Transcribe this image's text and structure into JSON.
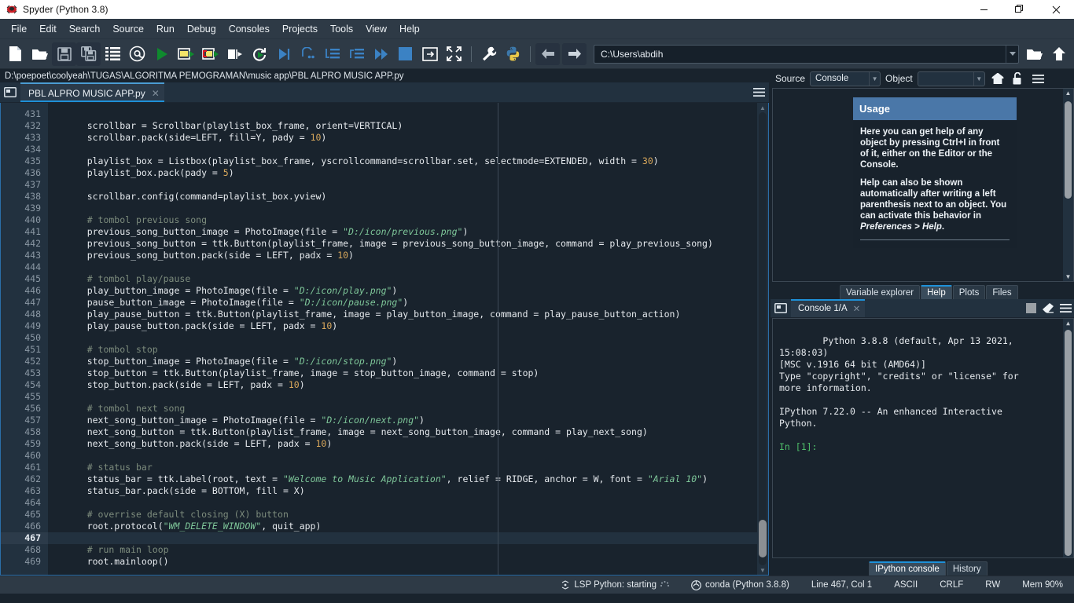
{
  "window": {
    "title": "Spyder (Python 3.8)",
    "app_icon": "spyder-logo-icon",
    "minimize": "minimize-icon",
    "maximize": "maximize-icon",
    "close": "close-icon"
  },
  "menubar": {
    "items": [
      "File",
      "Edit",
      "Search",
      "Source",
      "Run",
      "Debug",
      "Consoles",
      "Projects",
      "Tools",
      "View",
      "Help"
    ]
  },
  "toolbar": {
    "buttons": [
      {
        "name": "new-file-icon",
        "title": "New file"
      },
      {
        "name": "open-file-icon",
        "title": "Open file"
      },
      {
        "name": "save-file-icon",
        "title": "Save file"
      },
      {
        "name": "save-all-icon",
        "title": "Save all"
      },
      {
        "name": "file-switcher-icon",
        "title": "File switcher"
      },
      {
        "name": "find-symbols-icon",
        "title": "Symbol finder"
      },
      {
        "name": "run-file-icon",
        "title": "Run file"
      },
      {
        "name": "run-cell-icon",
        "title": "Run current cell"
      },
      {
        "name": "run-cell-advance-icon",
        "title": "Run cell and advance"
      },
      {
        "name": "run-selection-icon",
        "title": "Run selection"
      },
      {
        "name": "rerun-file-icon",
        "title": "Re-run last cell"
      },
      {
        "name": "debug-file-icon",
        "title": "Debug file"
      },
      {
        "name": "debug-step-over-icon",
        "title": "Step over"
      },
      {
        "name": "debug-step-into-icon",
        "title": "Step into"
      },
      {
        "name": "debug-step-return-icon",
        "title": "Step return"
      },
      {
        "name": "debug-continue-icon",
        "title": "Continue"
      },
      {
        "name": "debug-stop-icon",
        "title": "Stop debugging"
      },
      {
        "name": "maximize-pane-icon",
        "title": "Maximize current pane"
      },
      {
        "name": "fullscreen-icon",
        "title": "Fullscreen mode"
      },
      {
        "name": "preferences-icon",
        "title": "Preferences"
      },
      {
        "name": "pythonpath-icon",
        "title": "PYTHONPATH manager"
      }
    ],
    "back_icon": "arrow-left-icon",
    "forward_icon": "arrow-right-icon",
    "browse_icon": "folder-open-icon",
    "parent_icon": "arrow-up-icon",
    "path_value": "C:\\Users\\abdih",
    "path_dropdown_icon": "chevron-down-icon"
  },
  "editor": {
    "file_path": "D:\\poepoet\\coolyeah\\TUGAS\\ALGORITMA PEMOGRAMAN\\music app\\PBL ALPRO MUSIC APP.py",
    "browse_tabs_icon": "browse-tabs-icon",
    "options_icon": "options-hamburger-icon",
    "tab": {
      "label": "PBL ALPRO MUSIC APP.py",
      "close_icon": "close-tab-icon"
    },
    "first_line": 431,
    "current_line": 467,
    "scroll_up_icon": "scroll-up-arrow",
    "scroll_down_icon": "scroll-down-arrow",
    "lines": [
      [],
      [
        {
          "t": "    scrollbar = Scrollbar(playlist_box_frame, orient=VERTICAL)"
        }
      ],
      [
        {
          "t": "    scrollbar.pack(side=LEFT, fill=Y, pady = "
        },
        {
          "t": "10",
          "c": "num"
        },
        {
          "t": ")"
        }
      ],
      [],
      [
        {
          "t": "    playlist_box = Listbox(playlist_box_frame, yscrollcommand=scrollbar.set, selectmode=EXTENDED, width = "
        },
        {
          "t": "30",
          "c": "num"
        },
        {
          "t": ")"
        }
      ],
      [
        {
          "t": "    playlist_box.pack(pady = "
        },
        {
          "t": "5",
          "c": "num"
        },
        {
          "t": ")"
        }
      ],
      [],
      [
        {
          "t": "    scrollbar.config(command=playlist_box.yview)"
        }
      ],
      [],
      [
        {
          "t": "    # tombol previous song",
          "c": "cmt"
        }
      ],
      [
        {
          "t": "    previous_song_button_image = PhotoImage(file = "
        },
        {
          "t": "\"D:/icon/previous.png\"",
          "c": "str"
        },
        {
          "t": ")"
        }
      ],
      [
        {
          "t": "    previous_song_button = ttk.Button(playlist_frame, image = previous_song_button_image, command = play_previous_song)"
        }
      ],
      [
        {
          "t": "    previous_song_button.pack(side = LEFT, padx = "
        },
        {
          "t": "10",
          "c": "num"
        },
        {
          "t": ")"
        }
      ],
      [],
      [
        {
          "t": "    # tombol play/pause",
          "c": "cmt"
        }
      ],
      [
        {
          "t": "    play_button_image = PhotoImage(file = "
        },
        {
          "t": "\"D:/icon/play.png\"",
          "c": "str"
        },
        {
          "t": ")"
        }
      ],
      [
        {
          "t": "    pause_button_image = PhotoImage(file = "
        },
        {
          "t": "\"D:/icon/pause.png\"",
          "c": "str"
        },
        {
          "t": ")"
        }
      ],
      [
        {
          "t": "    play_pause_button = ttk.Button(playlist_frame, image = play_button_image, command = play_pause_button_action)"
        }
      ],
      [
        {
          "t": "    play_pause_button.pack(side = LEFT, padx = "
        },
        {
          "t": "10",
          "c": "num"
        },
        {
          "t": ")"
        }
      ],
      [],
      [
        {
          "t": "    # tombol stop",
          "c": "cmt"
        }
      ],
      [
        {
          "t": "    stop_button_image = PhotoImage(file = "
        },
        {
          "t": "\"D:/icon/stop.png\"",
          "c": "str"
        },
        {
          "t": ")"
        }
      ],
      [
        {
          "t": "    stop_button = ttk.Button(playlist_frame, image = stop_button_image, command = stop)"
        }
      ],
      [
        {
          "t": "    stop_button.pack(side = LEFT, padx = "
        },
        {
          "t": "10",
          "c": "num"
        },
        {
          "t": ")"
        }
      ],
      [],
      [
        {
          "t": "    # tombol next song",
          "c": "cmt"
        }
      ],
      [
        {
          "t": "    next_song_button_image = PhotoImage(file = "
        },
        {
          "t": "\"D:/icon/next.png\"",
          "c": "str"
        },
        {
          "t": ")"
        }
      ],
      [
        {
          "t": "    next_song_button = ttk.Button(playlist_frame, image = next_song_button_image, command = play_next_song)"
        }
      ],
      [
        {
          "t": "    next_song_button.pack(side = LEFT, padx = "
        },
        {
          "t": "10",
          "c": "num"
        },
        {
          "t": ")"
        }
      ],
      [],
      [
        {
          "t": "    # status bar",
          "c": "cmt"
        }
      ],
      [
        {
          "t": "    status_bar = ttk.Label(root, text = "
        },
        {
          "t": "\"Welcome to Music Application\"",
          "c": "str"
        },
        {
          "t": ", relief = RIDGE, anchor = W, font = "
        },
        {
          "t": "\"Arial 10\"",
          "c": "str"
        },
        {
          "t": ")"
        }
      ],
      [
        {
          "t": "    status_bar.pack(side = BOTTOM, fill = X)"
        }
      ],
      [],
      [
        {
          "t": "    # overrise default closing (X) button",
          "c": "cmt"
        }
      ],
      [
        {
          "t": "    root.protocol("
        },
        {
          "t": "\"WM_DELETE_WINDOW\"",
          "c": "str"
        },
        {
          "t": ", quit_app)"
        }
      ],
      [],
      [
        {
          "t": "    # run main loop",
          "c": "cmt"
        }
      ],
      [
        {
          "t": "    root.mainloop()"
        }
      ]
    ]
  },
  "help_pane": {
    "source_label": "Source",
    "source_value": "Console",
    "object_label": "Object",
    "object_value": "",
    "home_icon": "home-icon",
    "lock_icon": "unlock-icon",
    "options_icon": "options-hamburger-icon",
    "dropdown_icon": "chevron-down-icon",
    "usage_title": "Usage",
    "usage_paragraph_1": "Here you can get help of any object by pressing Ctrl+I in front of it, either on the Editor or the Console.",
    "usage_paragraph_2_pre": "Help can also be shown automatically after writing a left parenthesis next to an object. You can activate this behavior in ",
    "usage_paragraph_2_em": "Preferences > Help",
    "usage_paragraph_2_post": ".",
    "tabs": [
      {
        "label": "Variable explorer",
        "active": false
      },
      {
        "label": "Help",
        "active": true
      },
      {
        "label": "Plots",
        "active": false
      },
      {
        "label": "Files",
        "active": false
      }
    ]
  },
  "console_pane": {
    "browse_icon": "browse-tabs-icon",
    "tab_label": "Console 1/A",
    "tab_close_icon": "close-tab-icon",
    "stop_icon": "stop-square-icon",
    "clear_icon": "clear-console-icon",
    "options_icon": "options-hamburger-icon",
    "output_lines": [
      "Python 3.8.8 (default, Apr 13 2021, 15:08:03)",
      "[MSC v.1916 64 bit (AMD64)]",
      "Type \"copyright\", \"credits\" or \"license\" for",
      "more information.",
      "",
      "IPython 7.22.0 -- An enhanced Interactive",
      "Python.",
      ""
    ],
    "prompt": "In [1]:",
    "tabs": [
      {
        "label": "IPython console",
        "active": true
      },
      {
        "label": "History",
        "active": false
      }
    ]
  },
  "statusbar": {
    "lsp_icon": "lsp-status-icon",
    "lsp_text": "LSP Python: starting",
    "spinner_icon": "spinner-icon",
    "conda_icon": "conda-icon",
    "conda_text": "conda (Python 3.8.8)",
    "cursor_position": "Line 467, Col 1",
    "encoding": "ASCII",
    "eol": "CRLF",
    "permissions": "RW",
    "memory": "Mem 90%"
  },
  "colors": {
    "accent": "#1e90d8",
    "panel": "#19232d",
    "toolbar": "#2e3a46",
    "string": "#7ec699",
    "comment": "#7d8c7d",
    "number": "#d9a85c",
    "usage_header": "#4a77a8"
  }
}
